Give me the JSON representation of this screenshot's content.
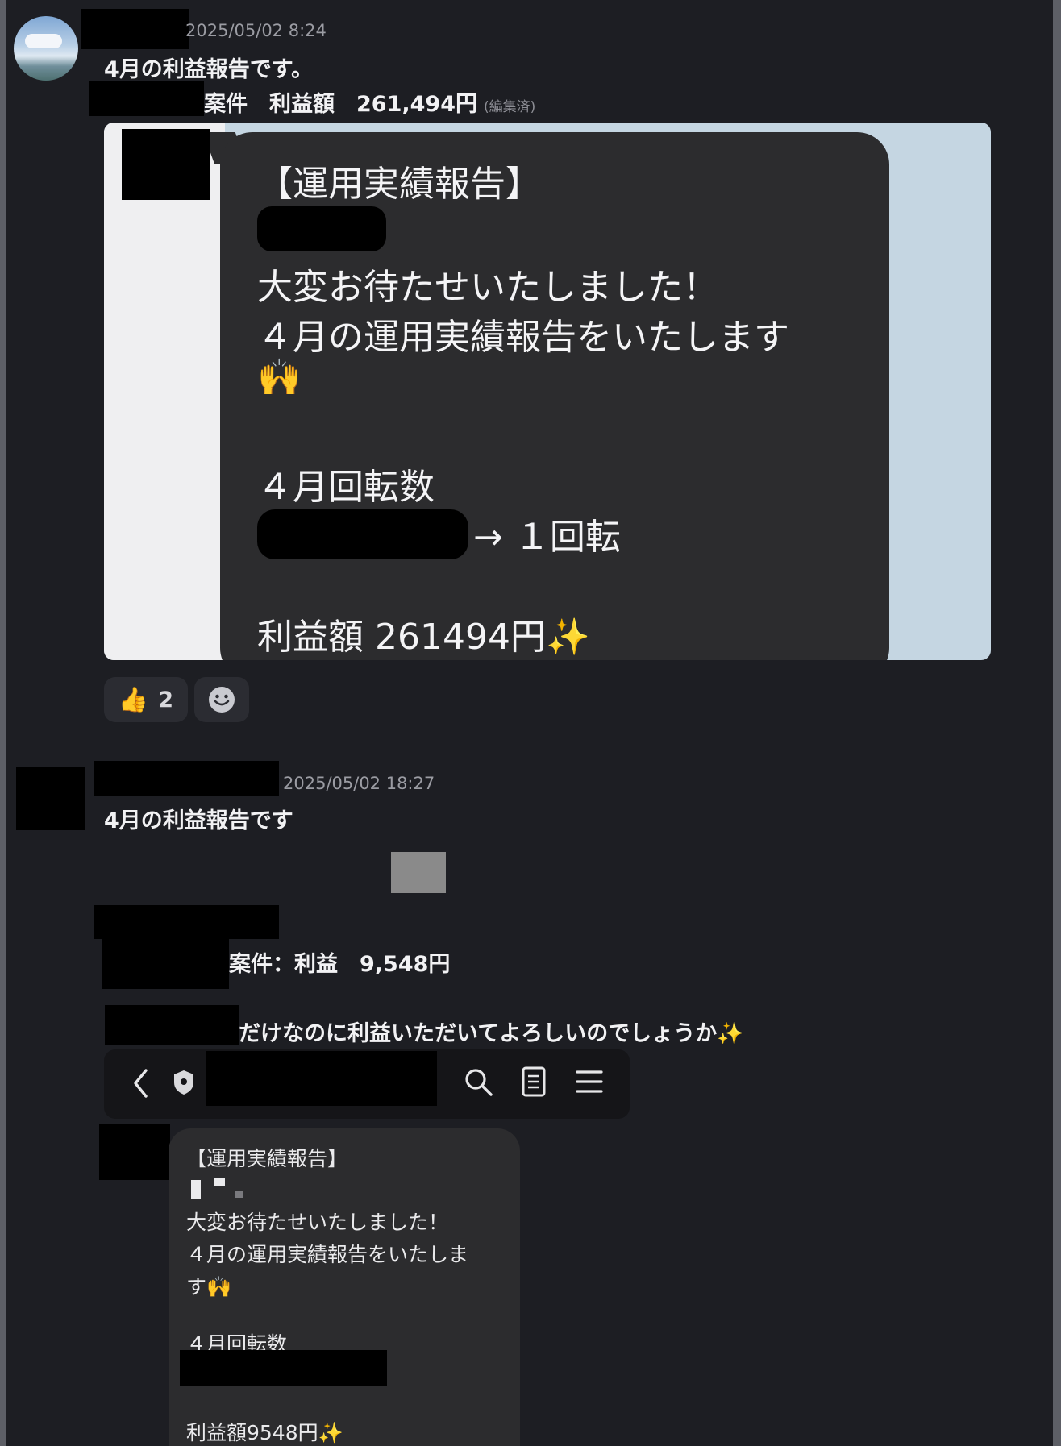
{
  "messages": [
    {
      "timestamp": "2025/05/02 8:24",
      "line1": "4月の利益報告です。",
      "line2": "案件　利益額　261,494円",
      "edited": "(編集済)",
      "image": {
        "title": "【運用実績報告】",
        "line1": "大変お待たせいたしました！",
        "line2": "４月の運用実績報告をいたします",
        "emoji1": "🙌",
        "heading": "４月回転数",
        "rotation": "→ １回転",
        "profit": "利益額 261494円",
        "emoji2": "✨"
      },
      "reactions": {
        "thumbs_emoji": "👍",
        "thumbs_count": "2"
      }
    },
    {
      "timestamp": "2025/05/02 18:27",
      "line1": "4月の利益報告です",
      "line2": "案件：利益　9,548円",
      "line3": "だけなのに利益いただいてよろしいのでしょうか",
      "line3_emoji": "✨",
      "image": {
        "title": "【運用実績報告】",
        "line1": "大変お待たせいたしました！",
        "line2": "４月の運用実績報告をいたしま",
        "line3": "す",
        "emoji1": "🙌",
        "heading": "４月回転数",
        "profit": "利益額9548円",
        "emoji2": "✨"
      }
    }
  ]
}
